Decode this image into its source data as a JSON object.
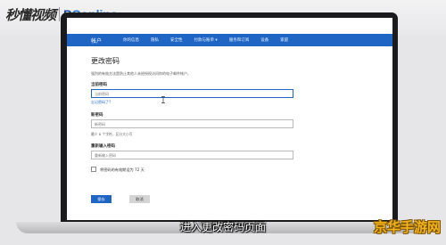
{
  "watermark": {
    "script": "秒懂视频",
    "brand_p": "P",
    "brand_rest": "Conline",
    "corner": "京华手游网"
  },
  "nav": {
    "brand": "帐户",
    "items": [
      "你的信息",
      "隐私",
      "安全性",
      "付款与账单 ▾",
      "服务和订阅",
      "设备",
      "家庭"
    ]
  },
  "page": {
    "title": "更改密码",
    "description": "强烈的有效方法是防止其他人未经授权访问你的电子邮件帐户。"
  },
  "form": {
    "current_label": "当前密码",
    "current_placeholder": "当前密码",
    "forgot_link": "忘记密码了?",
    "new_label": "新密码",
    "new_placeholder": "新密码",
    "hint": "最少 8 个字符，区分大小写",
    "confirm_label": "重新输入密码",
    "confirm_placeholder": "重新输入密码",
    "checkbox_label": "将密码的有效期设为 72 天",
    "save_label": "保存",
    "cancel_label": "取消"
  },
  "subtitle": "进入更改密码页面",
  "colors": {
    "accent": "#1f66c4",
    "watermark": "#f2b31d"
  }
}
